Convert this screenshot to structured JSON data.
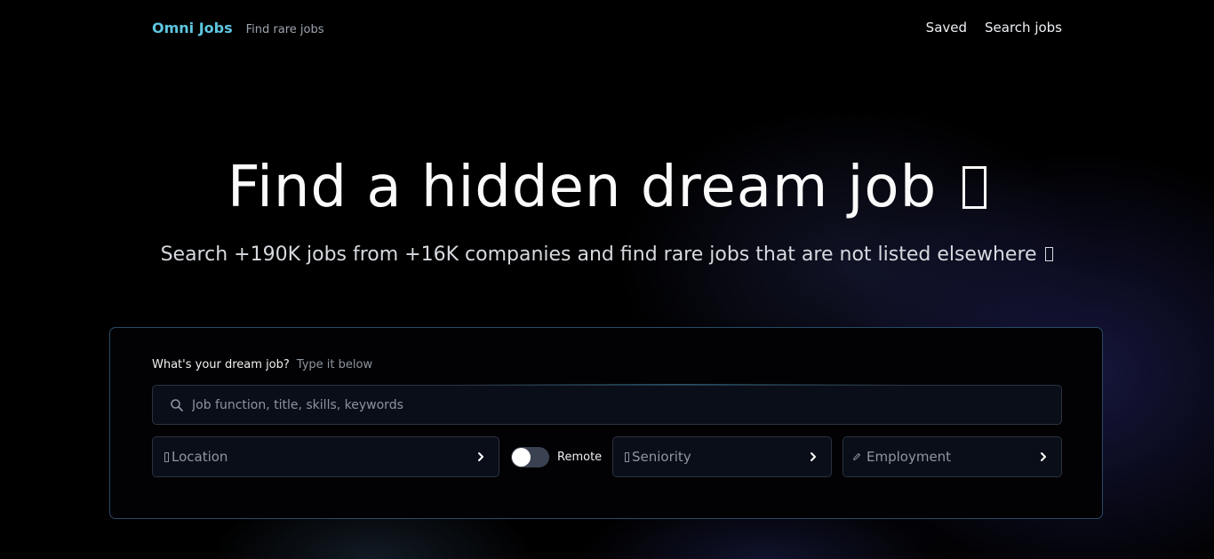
{
  "nav": {
    "brand": "Omni Jobs",
    "tagline": "Find rare jobs",
    "links": [
      {
        "label": "Saved",
        "icon": ""
      },
      {
        "label": "Search jobs",
        "icon": ""
      }
    ]
  },
  "hero": {
    "title": "Find a hidden dream job",
    "subtitle": "Search +190K jobs from +16K companies and find rare jobs that are not listed elsewhere"
  },
  "search": {
    "prompt_label": "What's your dream job?",
    "prompt_hint": "Type it below",
    "placeholder": "Job function, title, skills, keywords",
    "value": ""
  },
  "filters": {
    "location": {
      "label": "Location",
      "icon": "emoji-placeholder"
    },
    "remote": {
      "label": "Remote",
      "checked": false
    },
    "seniority": {
      "label": "Seniority",
      "icon": "emoji-placeholder"
    },
    "employment": {
      "label": "Employment",
      "icon": "pencil-icon"
    }
  },
  "colors": {
    "brand": "#5ec6e0",
    "card_border": "#2a4a66",
    "field_bg": "#0a0e18"
  }
}
